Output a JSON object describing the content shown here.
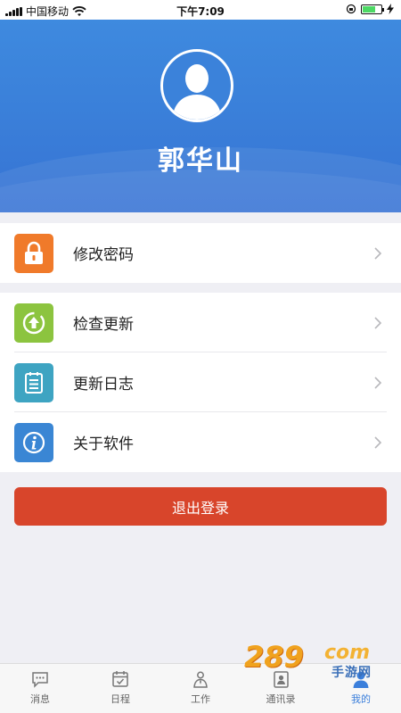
{
  "status_bar": {
    "carrier": "中国移动",
    "time": "下午7:09"
  },
  "profile": {
    "name": "郭华山"
  },
  "menu_groups": [
    [
      {
        "label": "修改密码",
        "icon": "lock-icon",
        "color": "#f07a2a"
      }
    ],
    [
      {
        "label": "检查更新",
        "icon": "update-arrow-icon",
        "color": "#8cc43f"
      },
      {
        "label": "更新日志",
        "icon": "log-list-icon",
        "color": "#3ea4c2"
      },
      {
        "label": "关于软件",
        "icon": "info-icon",
        "color": "#3a86d4"
      }
    ]
  ],
  "logout_button": {
    "label": "退出登录",
    "color": "#d8452b"
  },
  "tabbar": {
    "tabs": [
      {
        "label": "消息",
        "icon": "message-icon",
        "active": false
      },
      {
        "label": "日程",
        "icon": "calendar-icon",
        "active": false
      },
      {
        "label": "工作",
        "icon": "work-icon",
        "active": false
      },
      {
        "label": "通讯录",
        "icon": "contacts-icon",
        "active": false
      },
      {
        "label": "我的",
        "icon": "me-icon",
        "active": true
      }
    ],
    "active_color": "#3b7fdb"
  },
  "watermark": {
    "num": "289",
    "com": "com",
    "sub": "手游网"
  }
}
